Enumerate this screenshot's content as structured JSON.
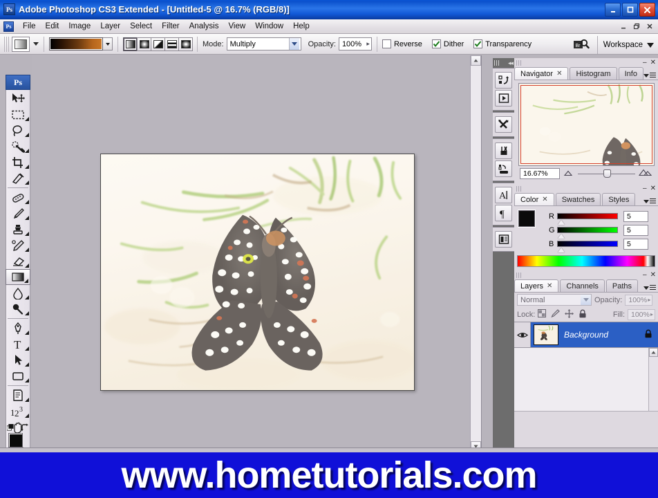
{
  "window": {
    "app_icon": "Ps",
    "title": "Adobe Photoshop CS3 Extended - [Untitled-5 @ 16.7% (RGB/8)]",
    "minimize_label": "–",
    "maximize_label": "□",
    "close_label": "✕"
  },
  "menubar": {
    "icon": "Ps",
    "items": [
      {
        "label": "File"
      },
      {
        "label": "Edit"
      },
      {
        "label": "Image"
      },
      {
        "label": "Layer"
      },
      {
        "label": "Select"
      },
      {
        "label": "Filter"
      },
      {
        "label": "Analysis"
      },
      {
        "label": "View"
      },
      {
        "label": "Window"
      },
      {
        "label": "Help"
      }
    ],
    "doc_minimize": "–",
    "doc_restore": "❐",
    "doc_close": "✕"
  },
  "options_bar": {
    "tool_preset_name": "gradient-preset",
    "gradient_picker_name": "Black to Copper",
    "gradient_from": "#000000",
    "gradient_to": "#c97626",
    "gradient_types": [
      {
        "name": "Linear Gradient",
        "selected": true
      },
      {
        "name": "Radial Gradient",
        "selected": false
      },
      {
        "name": "Angle Gradient",
        "selected": false
      },
      {
        "name": "Reflected Gradient",
        "selected": false
      },
      {
        "name": "Diamond Gradient",
        "selected": false
      }
    ],
    "mode_label": "Mode:",
    "mode_value": "Multiply",
    "opacity_label": "Opacity:",
    "opacity_value": "100%",
    "checkboxes": [
      {
        "label": "Reverse",
        "checked": false
      },
      {
        "label": "Dither",
        "checked": true
      },
      {
        "label": "Transparency",
        "checked": true
      }
    ],
    "workspace_label": "Workspace"
  },
  "toolbar": {
    "logo": "Ps",
    "tools": [
      {
        "name": "move-tool",
        "selected": false
      },
      {
        "name": "rectangular-marquee-tool",
        "selected": false
      },
      {
        "name": "lasso-tool",
        "selected": false
      },
      {
        "name": "quick-selection-tool",
        "selected": false
      },
      {
        "name": "crop-tool",
        "selected": false
      },
      {
        "name": "slice-tool",
        "selected": false
      },
      {
        "name": "healing-brush-tool",
        "selected": false
      },
      {
        "name": "brush-tool",
        "selected": false
      },
      {
        "name": "clone-stamp-tool",
        "selected": false
      },
      {
        "name": "history-brush-tool",
        "selected": false
      },
      {
        "name": "eraser-tool",
        "selected": false
      },
      {
        "name": "gradient-tool",
        "selected": true
      },
      {
        "name": "blur-tool",
        "selected": false
      },
      {
        "name": "dodge-tool",
        "selected": false
      },
      {
        "name": "pen-tool",
        "selected": false
      },
      {
        "name": "type-tool",
        "selected": false
      },
      {
        "name": "path-selection-tool",
        "selected": false
      },
      {
        "name": "rectangle-shape-tool",
        "selected": false
      },
      {
        "name": "notes-tool",
        "selected": false
      },
      {
        "name": "count-tool",
        "selected": false
      },
      {
        "name": "hand-tool",
        "selected": false
      },
      {
        "name": "zoom-tool",
        "selected": false
      }
    ],
    "foreground_color": "#0a0a0a",
    "background_color": "#c8803e"
  },
  "icon_dock": {
    "buttons": [
      {
        "name": "history-panel-icon"
      },
      {
        "name": "actions-panel-icon"
      },
      {
        "name": "tool-presets-panel-icon"
      },
      {
        "name": "brushes-panel-icon"
      },
      {
        "name": "clone-source-panel-icon"
      },
      {
        "name": "character-panel-icon"
      },
      {
        "name": "paragraph-panel-icon"
      },
      {
        "name": "layer-comps-panel-icon"
      }
    ]
  },
  "navigator_panel": {
    "tabs": [
      {
        "label": "Navigator",
        "active": true,
        "closable": true
      },
      {
        "label": "Histogram",
        "active": false,
        "closable": false
      },
      {
        "label": "Info",
        "active": false,
        "closable": false
      }
    ],
    "zoom_value": "16.67%",
    "view_box_color": "#d4402a",
    "minimize_label": "–",
    "close_label": "✕"
  },
  "color_panel": {
    "tabs": [
      {
        "label": "Color",
        "active": true,
        "closable": true
      },
      {
        "label": "Swatches",
        "active": false,
        "closable": false
      },
      {
        "label": "Styles",
        "active": false,
        "closable": false
      }
    ],
    "channels": [
      {
        "name": "R",
        "value": "5"
      },
      {
        "name": "G",
        "value": "5"
      },
      {
        "name": "B",
        "value": "5"
      }
    ],
    "foreground_color": "#0a0a0a",
    "background_color": "#c8803e",
    "minimize_label": "–",
    "close_label": "✕"
  },
  "layers_panel": {
    "tabs": [
      {
        "label": "Layers",
        "active": true,
        "closable": true
      },
      {
        "label": "Channels",
        "active": false,
        "closable": false
      },
      {
        "label": "Paths",
        "active": false,
        "closable": false
      }
    ],
    "blend_mode": "Normal",
    "opacity_label": "Opacity:",
    "opacity_value": "100%",
    "lock_label": "Lock:",
    "fill_label": "Fill:",
    "fill_value": "100%",
    "layers": [
      {
        "name": "Background",
        "visible": true,
        "locked": true,
        "selected": true
      }
    ],
    "minimize_label": "–",
    "close_label": "✕"
  },
  "document": {
    "name": "Untitled-5",
    "zoom": "16.7%",
    "color_mode": "RGB/8",
    "image_description": "Faded washed-out photo of a dark checkerspot butterfly resting on pale sand with green grass blades"
  },
  "banner": {
    "text": "www.hometutorials.com",
    "background_color": "#1010d8",
    "text_color": "#ffffff"
  }
}
